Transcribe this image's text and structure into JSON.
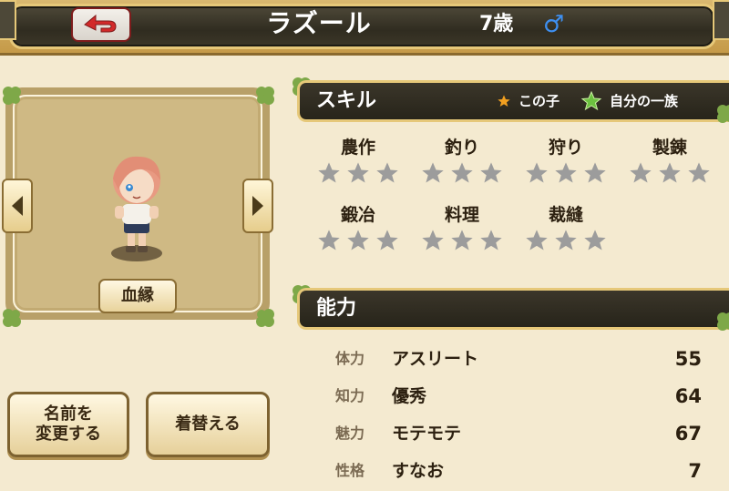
{
  "header": {
    "name": "ラズール",
    "age": "7歳",
    "gender_symbol": "♂",
    "back_icon": "back-arrow-icon"
  },
  "portrait": {
    "lineage_button": "血縁",
    "prev_icon": "left-arrow-icon",
    "next_icon": "right-arrow-icon"
  },
  "actions": {
    "rename_button": "名前を\n変更する",
    "dress_button": "着替える"
  },
  "skills": {
    "title": "スキル",
    "legend_self": "この子",
    "legend_family": "自分の一族",
    "items": [
      {
        "name": "農作",
        "stars": 0,
        "max": 3
      },
      {
        "name": "釣り",
        "stars": 0,
        "max": 3
      },
      {
        "name": "狩り",
        "stars": 0,
        "max": 3
      },
      {
        "name": "製錬",
        "stars": 0,
        "max": 3
      },
      {
        "name": "鍛冶",
        "stars": 0,
        "max": 3
      },
      {
        "name": "料理",
        "stars": 0,
        "max": 3
      },
      {
        "name": "裁縫",
        "stars": 0,
        "max": 3
      }
    ]
  },
  "abilities": {
    "title": "能力",
    "rows": [
      {
        "label": "体力",
        "desc": "アスリート",
        "value": "55"
      },
      {
        "label": "知力",
        "desc": "優秀",
        "value": "64"
      },
      {
        "label": "魅力",
        "desc": "モテモテ",
        "value": "67"
      },
      {
        "label": "性格",
        "desc": "すなお",
        "value": "7"
      }
    ]
  },
  "colors": {
    "star_empty": "#9c9c9c",
    "star_self": "#f2a020",
    "star_family": "#6cc040",
    "accent_gold": "#e6c879",
    "gender_blue": "#3e8ff0"
  }
}
